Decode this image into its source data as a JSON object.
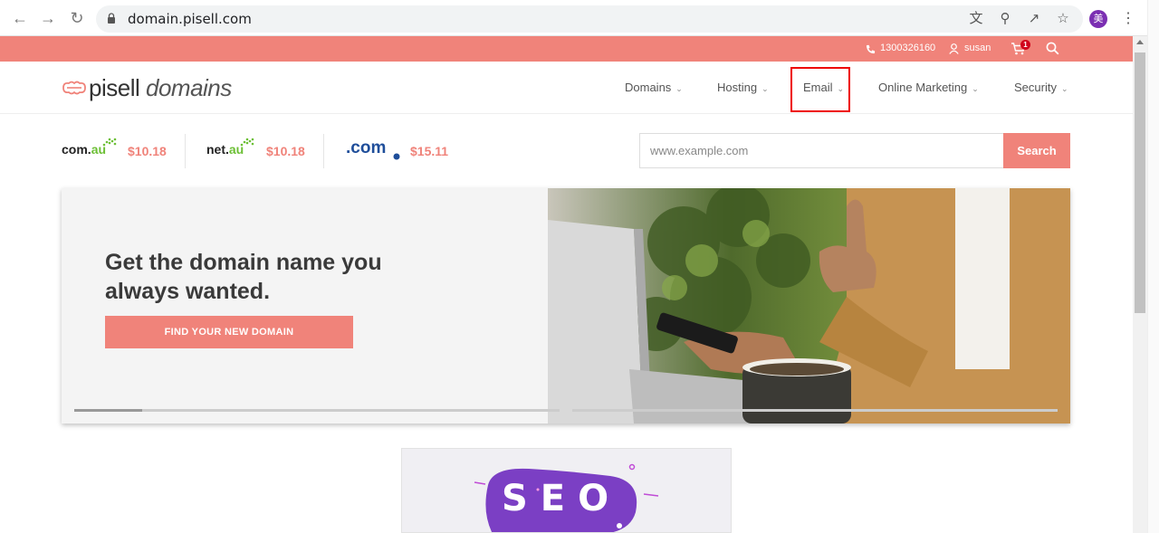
{
  "browser": {
    "url": "domain.pisell.com",
    "profile_initial": "美"
  },
  "topbar": {
    "phone": "1300326160",
    "user": "susan",
    "cart_count": "1"
  },
  "header": {
    "logo_main": "pisell",
    "logo_sub": "domains",
    "menu": [
      {
        "label": "Domains"
      },
      {
        "label": "Hosting"
      },
      {
        "label": "Email"
      },
      {
        "label": "Online Marketing"
      },
      {
        "label": "Security"
      }
    ]
  },
  "tlds": [
    {
      "name_main": "com.",
      "name_accent": "au",
      "price": "$10.18"
    },
    {
      "name_main": "net.",
      "name_accent": "au",
      "price": "$10.18"
    },
    {
      "name_main": ".com",
      "name_accent": "",
      "price": "$15.11"
    }
  ],
  "search": {
    "placeholder": "www.example.com",
    "button_label": "Search"
  },
  "hero": {
    "title": "Get the domain name you always wanted.",
    "button_label": "FIND YOUR NEW DOMAIN",
    "progress": 0.14
  },
  "seo_card": {
    "text": "SEO"
  },
  "colors": {
    "brand": "#f0837a",
    "highlight": "#ee0000"
  }
}
